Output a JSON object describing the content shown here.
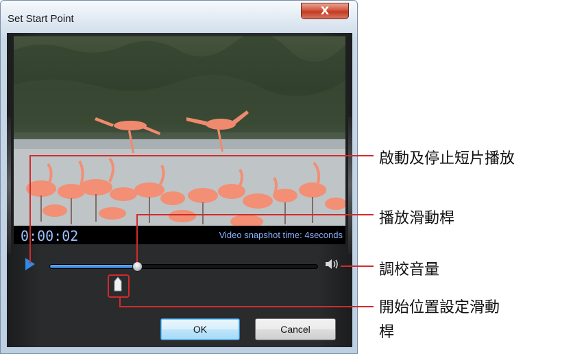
{
  "window": {
    "title": "Set Start Point",
    "close_label": "X"
  },
  "video": {
    "timecode": "0:00:02",
    "snapshot_text": "Video snapshot time: 4seconds"
  },
  "player": {
    "progress_fraction": 0.33
  },
  "buttons": {
    "ok_label": "OK",
    "cancel_label": "Cancel"
  },
  "annotations": {
    "play_stop": "啟動及停止短片播放",
    "playback_slider": "播放滑動桿",
    "volume": "調校音量",
    "start_slider_line1": "開始位置設定滑動",
    "start_slider_line2": "桿"
  },
  "colors": {
    "annotation_line": "#d12b2b",
    "play_accent": "#2f8be8"
  }
}
